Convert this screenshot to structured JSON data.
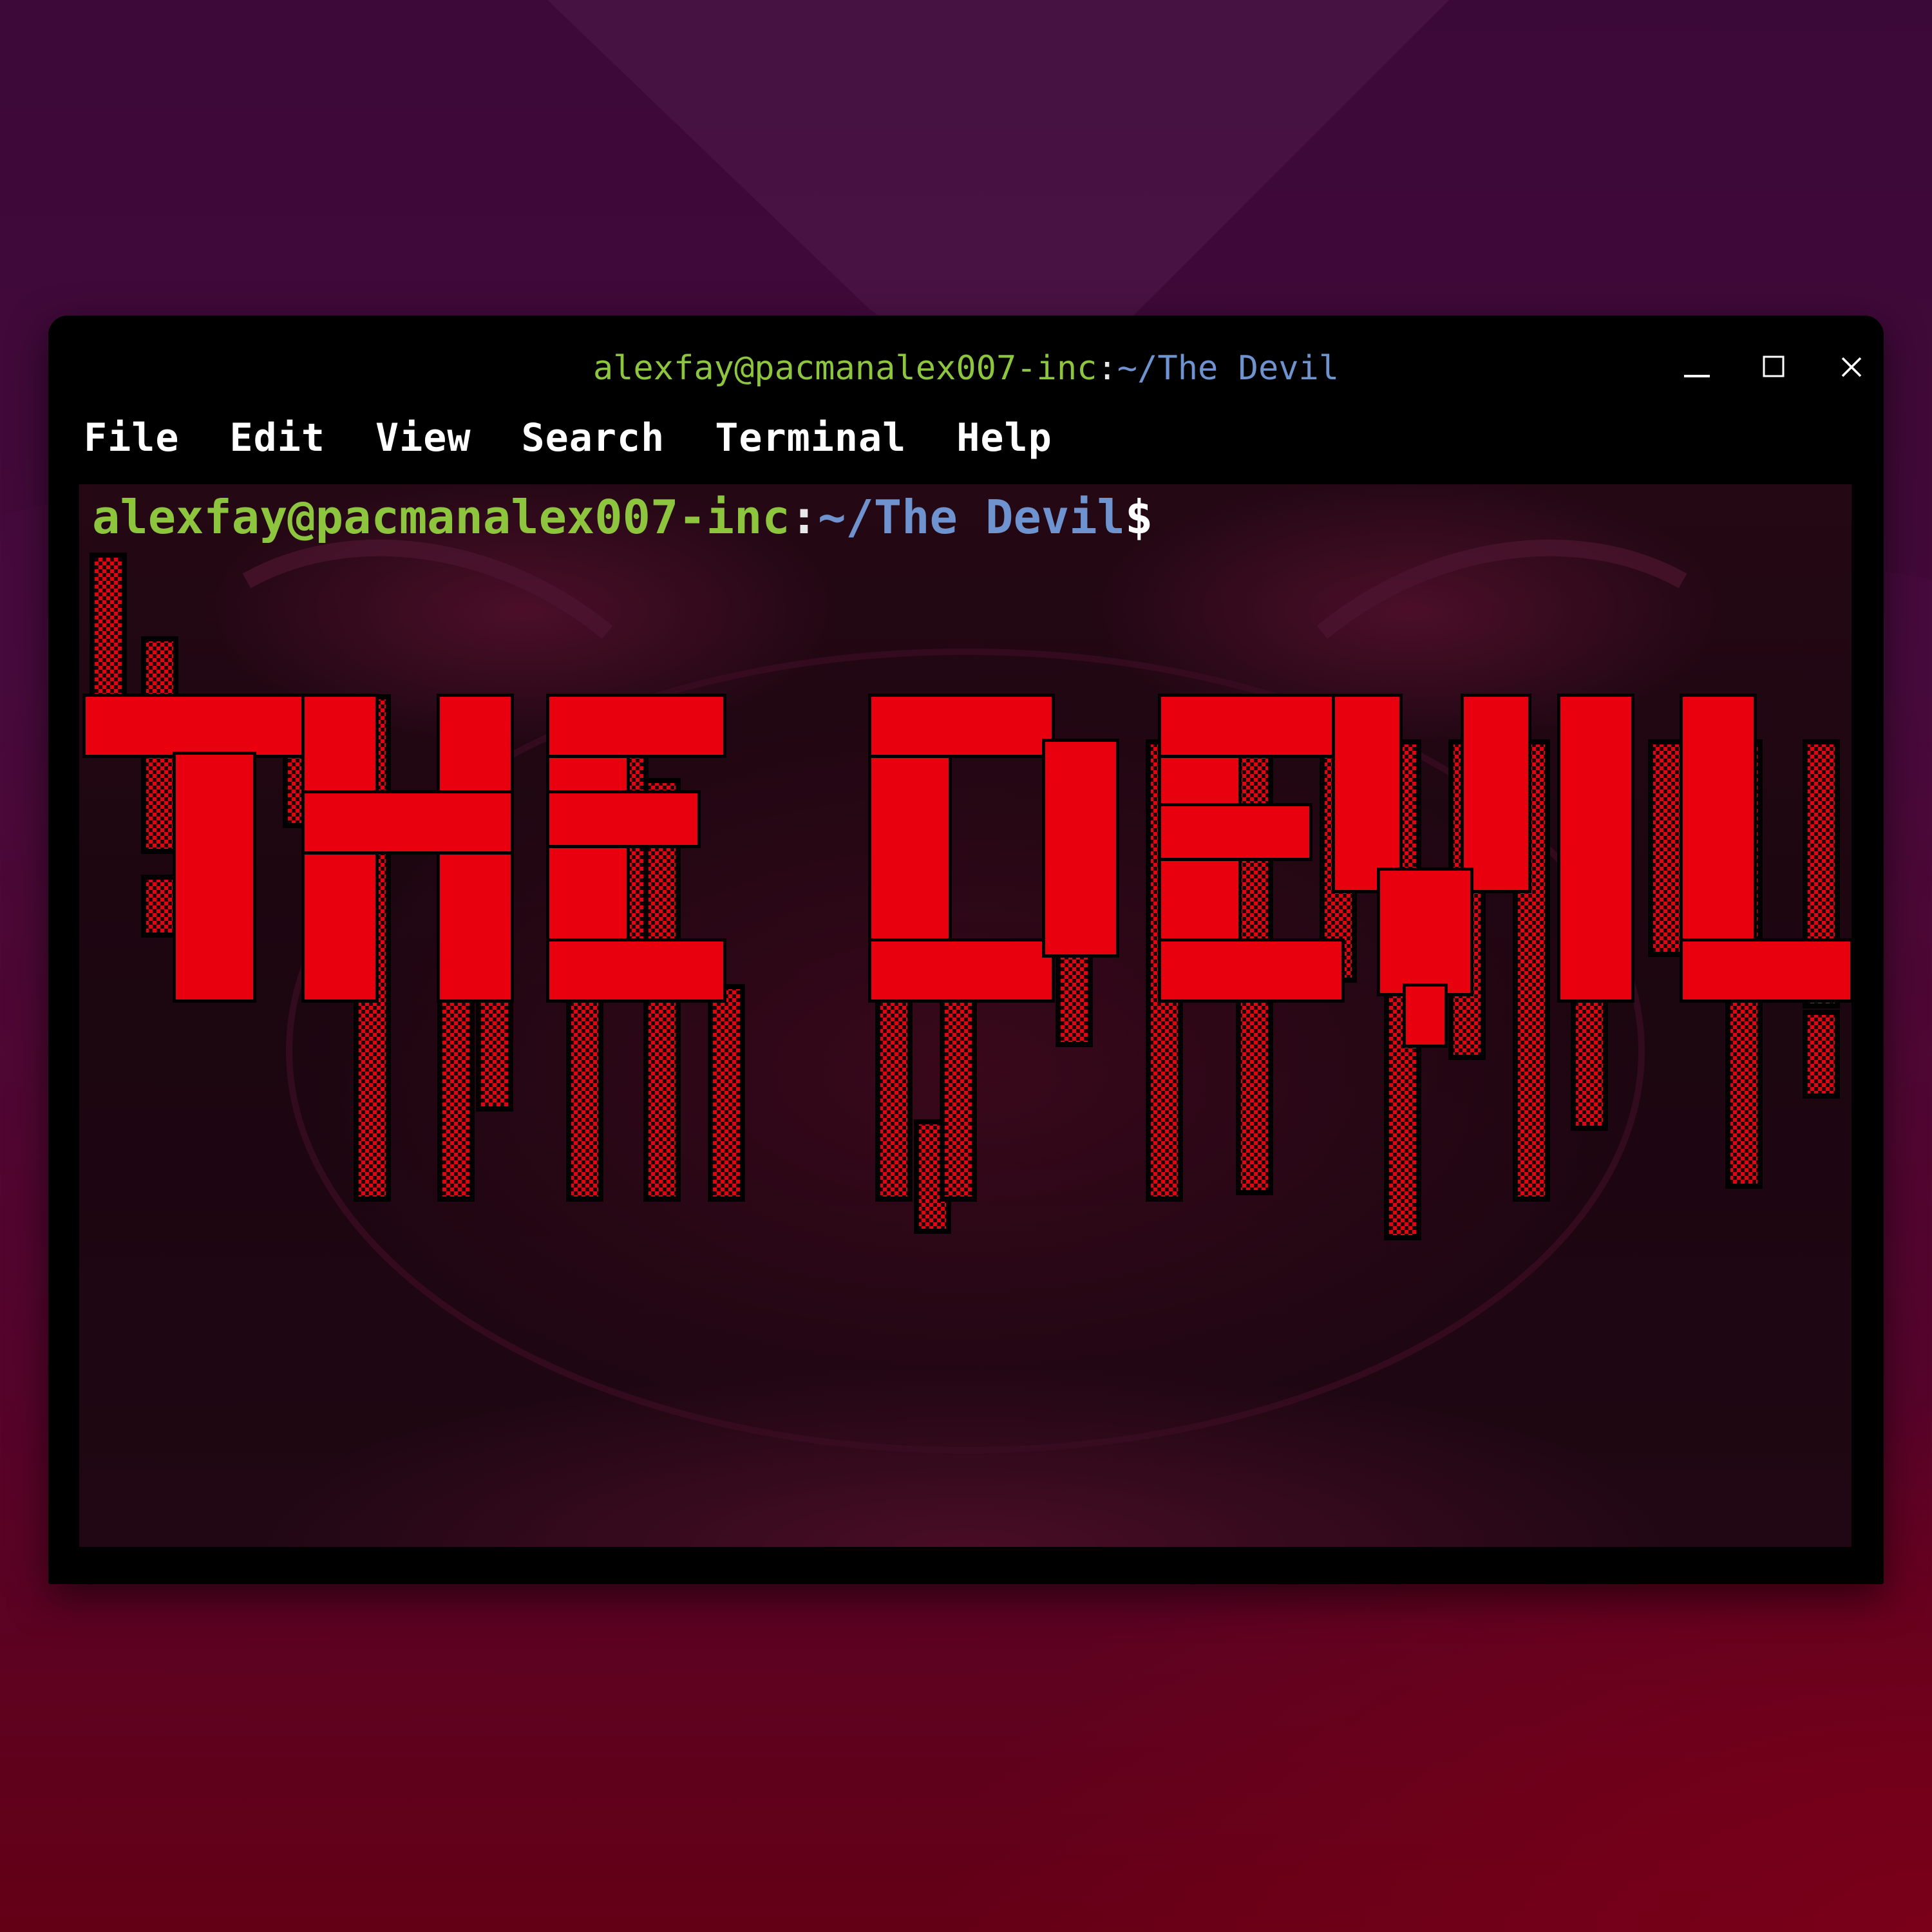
{
  "window": {
    "title_user_host": "alexfay@pacmanalex007-inc",
    "title_sep": ":",
    "title_path": "~/The Devil",
    "buttons": {
      "minimize_icon": "minimize-icon",
      "maximize_icon": "maximize-icon",
      "close_icon": "close-icon"
    }
  },
  "menu": [
    {
      "label": "File"
    },
    {
      "label": "Edit"
    },
    {
      "label": "View"
    },
    {
      "label": "Search"
    },
    {
      "label": "Terminal"
    },
    {
      "label": "Help"
    }
  ],
  "terminal": {
    "prompt_user_host": "alexfay@pacmanalex007-inc",
    "prompt_sep": ":",
    "prompt_path": "~/The Devil",
    "prompt_symbol": "$",
    "ascii_banner": "THE DEVIL"
  },
  "colors": {
    "user_host": "#8ec53f",
    "path": "#6f93cf",
    "banner": "#e8000f",
    "window_bg": "#000000"
  }
}
